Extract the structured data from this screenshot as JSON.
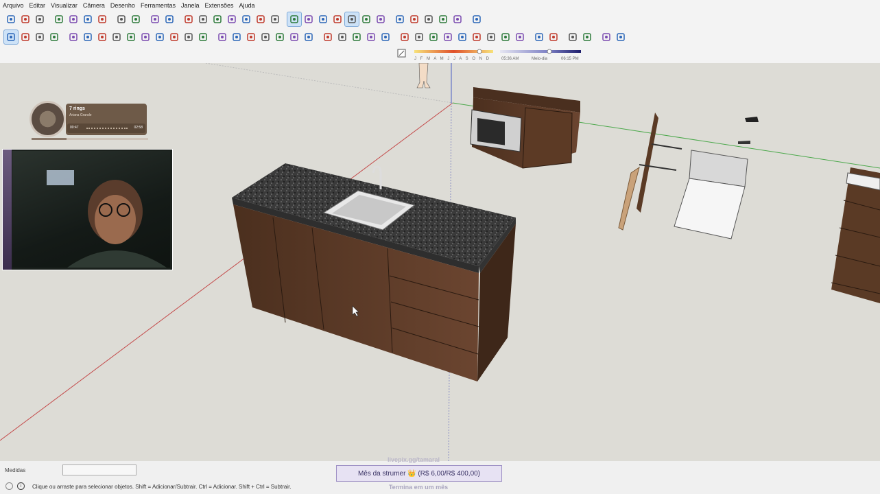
{
  "menu": [
    "Arquivo",
    "Editar",
    "Visualizar",
    "Câmera",
    "Desenho",
    "Ferramentas",
    "Janela",
    "Extensões",
    "Ajuda"
  ],
  "shadow": {
    "months": "J F M A M J J A S O N D",
    "time_start": "05:36 AM",
    "time_mid": "Meio-dia",
    "time_end": "06:15 PM"
  },
  "now_playing": {
    "title": "7 rings",
    "artist": "Ariana Grande",
    "elapsed": "00:47",
    "duration": "02:58",
    "progress": 0.3
  },
  "status": {
    "measure_label": "Medidas",
    "measure_value": "",
    "help_text": "Clique ou arraste para selecionar objetos. Shift = Adicionar/Subtrair. Ctrl = Adicionar. Shift + Ctrl = Subtrair."
  },
  "goal": {
    "url": "livepix.gg/tamaral",
    "label": "Mês da strumer 👑 (R$ 6,00/R$ 400,00)",
    "subtitle": "Termina em um mês"
  },
  "colors": {
    "axis_red": "#c44a4a",
    "axis_green": "#4aa84a",
    "axis_blue": "#4a5ec4",
    "cabinet": "#5a3a25"
  },
  "icons": {
    "row1": [
      "new-file-icon",
      "open-file-icon",
      "save-icon",
      "cut-icon",
      "copy-icon",
      "paste-icon",
      "delete-icon",
      "undo-icon",
      "redo-icon",
      "print-icon",
      "model-info-icon",
      "iso-view-icon",
      "top-view-icon",
      "front-view-icon",
      "right-view-icon",
      "back-view-icon",
      "left-view-icon",
      "bottom-view-icon",
      "xray-icon",
      "back-edges-icon",
      "wireframe-icon",
      "hidden-line-icon",
      "shaded-icon",
      "textured-icon",
      "monochrome-icon",
      "section-plane-icon",
      "section-fill-icon",
      "components-icon",
      "warehouse-icon",
      "extension-icon",
      "user-icon"
    ],
    "row2": [
      "select-icon",
      "component-icon",
      "paint-bucket-icon",
      "eraser-icon",
      "line-icon",
      "freehand-icon",
      "rectangle-icon",
      "rotated-rect-icon",
      "circle-icon",
      "polygon-icon",
      "arc-icon",
      "two-point-arc-icon",
      "three-point-arc-icon",
      "pie-icon",
      "move-icon",
      "push-pull-icon",
      "rotate-icon",
      "scale-icon",
      "follow-me-icon",
      "offset-icon",
      "tape-measure-icon",
      "dimension-icon",
      "protractor-icon",
      "text-icon",
      "axes-icon",
      "3d-text-icon",
      "orbit-icon",
      "pan-icon",
      "zoom-icon",
      "zoom-window-icon",
      "zoom-extents-icon",
      "previous-view-icon",
      "position-camera-icon",
      "look-around-icon",
      "walk-icon",
      "sandbox-icon",
      "box-icon",
      "cube-icon",
      "triangle-icon",
      "curve-icon",
      "layers-icon"
    ]
  }
}
